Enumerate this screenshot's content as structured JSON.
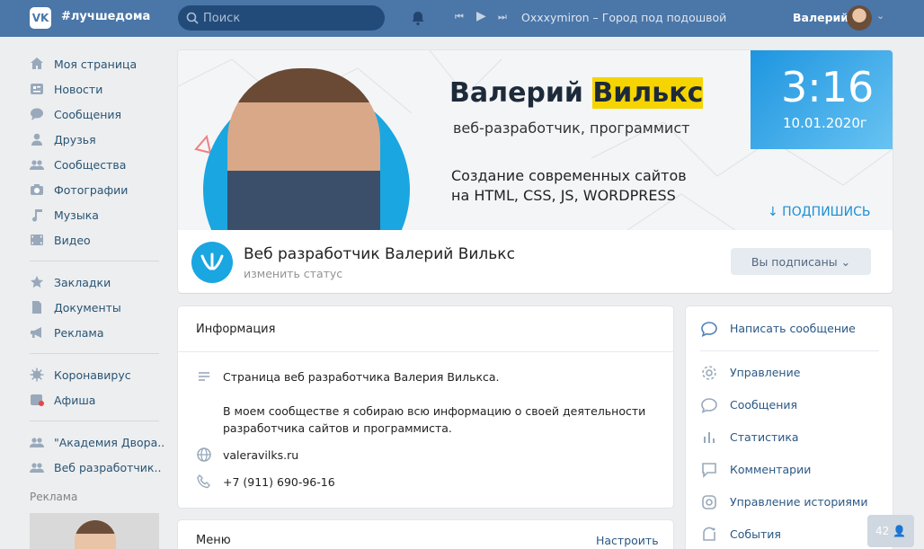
{
  "header": {
    "logo": "VK",
    "hashtag": "#лучшедома",
    "search_placeholder": "Поиск",
    "track": "Oxxxymiron – Город под подошвой",
    "user_name": "Валерий"
  },
  "sidebar": {
    "items": [
      {
        "label": "Моя страница",
        "icon": "home-icon"
      },
      {
        "label": "Новости",
        "icon": "news-icon"
      },
      {
        "label": "Сообщения",
        "icon": "messages-icon"
      },
      {
        "label": "Друзья",
        "icon": "friends-icon"
      },
      {
        "label": "Сообщества",
        "icon": "groups-icon"
      },
      {
        "label": "Фотографии",
        "icon": "camera-icon"
      },
      {
        "label": "Музыка",
        "icon": "music-icon"
      },
      {
        "label": "Видео",
        "icon": "video-icon"
      },
      {
        "label": "Закладки",
        "icon": "star-icon"
      },
      {
        "label": "Документы",
        "icon": "document-icon"
      },
      {
        "label": "Реклама",
        "icon": "megaphone-icon"
      },
      {
        "label": "Коронавирус",
        "icon": "virus-icon"
      },
      {
        "label": "Афиша",
        "icon": "afisha-icon"
      },
      {
        "label": "\"Академия Двора..",
        "icon": "group-icon"
      },
      {
        "label": "Веб разработчик..",
        "icon": "group-icon"
      }
    ],
    "ad_label": "Реклама"
  },
  "cover": {
    "name_part1": "Валерий ",
    "name_part2": "Вилькс",
    "role": "веб-разработчик, программист",
    "tagline1": "Создание современных сайтов",
    "tagline2": "на HTML, CSS, JS, WORDPRESS",
    "time": "3:16",
    "date": "10.01.2020г",
    "subscribe": "↓ ПОДПИШИСЬ"
  },
  "group": {
    "name": "Веб разработчик Валерий Вилькс",
    "status_link": "изменить статус",
    "subscribed_button": "Вы подписаны ⌄"
  },
  "info": {
    "title": "Информация",
    "description1": "Страница веб разработчика Валерия Вилькса.",
    "description2": "В моем сообществе я собираю всю информацию о своей деятельности",
    "description3": "разработчика сайтов и программиста.",
    "website": "valeravilks.ru",
    "phone": "+7 (911) 690-96-16"
  },
  "menu": {
    "title": "Меню",
    "action": "Настроить"
  },
  "actions": [
    {
      "label": "Написать сообщение",
      "icon": "chat-icon"
    },
    {
      "label": "Управление",
      "icon": "gear-icon"
    },
    {
      "label": "Сообщения",
      "icon": "chat-icon"
    },
    {
      "label": "Статистика",
      "icon": "stats-icon"
    },
    {
      "label": "Комментарии",
      "icon": "comment-icon"
    },
    {
      "label": "Управление историями",
      "icon": "stories-icon"
    },
    {
      "label": "События",
      "icon": "events-icon"
    }
  ],
  "counter": "42 👤",
  "colors": {
    "brand": "#4a76a8",
    "link": "#2a5885",
    "accent": "#1aa6e0"
  }
}
